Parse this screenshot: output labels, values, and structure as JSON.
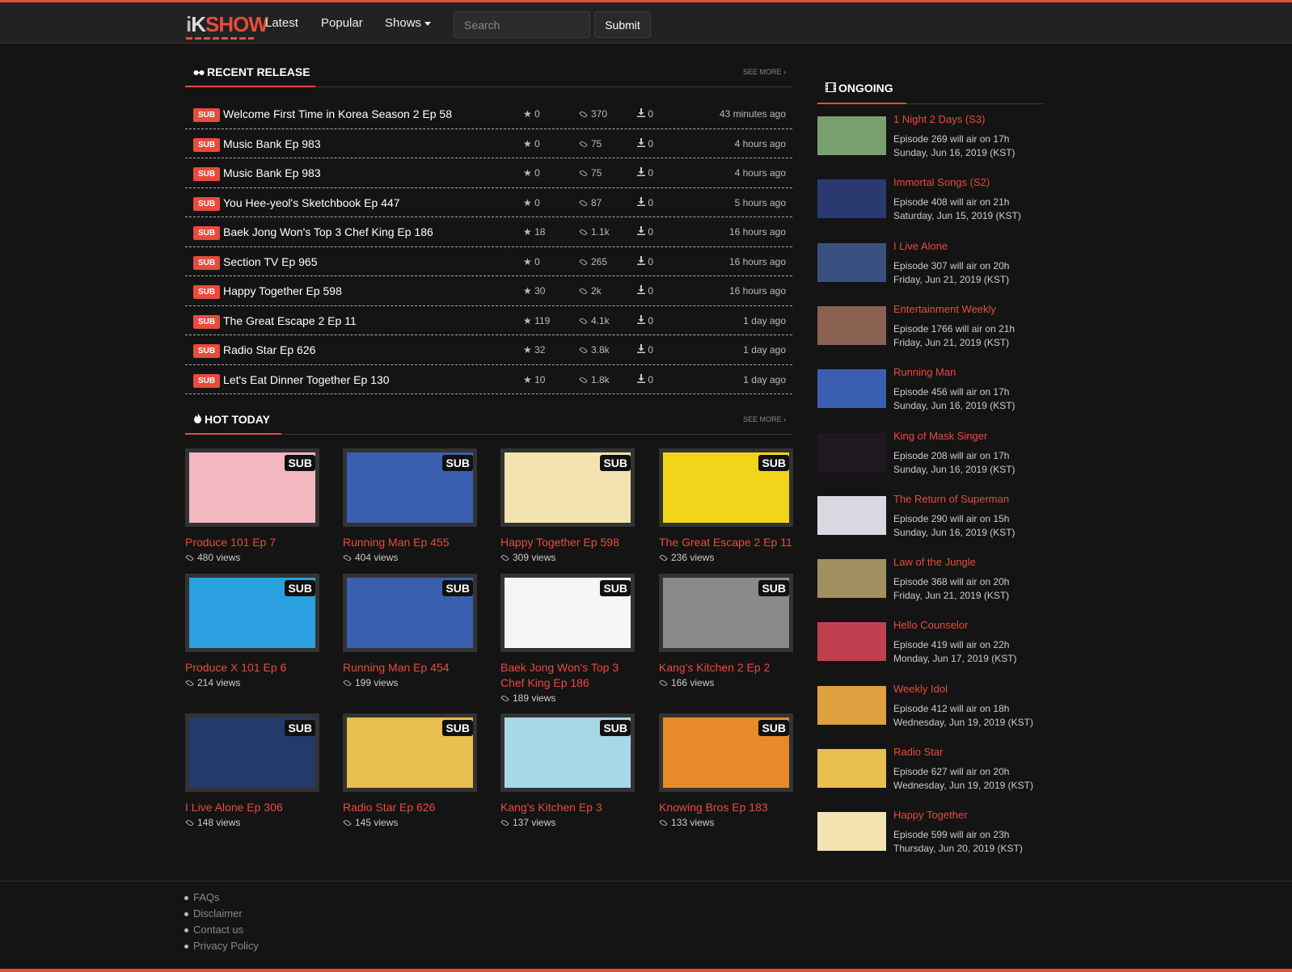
{
  "brand": {
    "logo_i": "i",
    "logo_k": "K",
    "logo_show": "SHOW"
  },
  "nav": {
    "latest": "Latest",
    "popular": "Popular",
    "shows": "Shows",
    "search_placeholder": "Search",
    "submit": "Submit"
  },
  "recent": {
    "title": "RECENT RELEASE",
    "see_more": "SEE MORE",
    "badge": "SUB",
    "items": [
      {
        "title": "Welcome First Time in Korea Season 2 Ep 58",
        "stars": "0",
        "views": "370",
        "downloads": "0",
        "time": "43 minutes ago"
      },
      {
        "title": "Music Bank Ep 983",
        "stars": "0",
        "views": "75",
        "downloads": "0",
        "time": "4 hours ago"
      },
      {
        "title": "Music Bank Ep 983",
        "stars": "0",
        "views": "75",
        "downloads": "0",
        "time": "4 hours ago"
      },
      {
        "title": "You Hee-yeol's Sketchbook Ep 447",
        "stars": "0",
        "views": "87",
        "downloads": "0",
        "time": "5 hours ago"
      },
      {
        "title": "Baek Jong Won's Top 3 Chef King Ep 186",
        "stars": "18",
        "views": "1.1k",
        "downloads": "0",
        "time": "16 hours ago"
      },
      {
        "title": "Section TV Ep 965",
        "stars": "0",
        "views": "265",
        "downloads": "0",
        "time": "16 hours ago"
      },
      {
        "title": "Happy Together Ep 598",
        "stars": "30",
        "views": "2k",
        "downloads": "0",
        "time": "16 hours ago"
      },
      {
        "title": "The Great Escape 2 Ep 11",
        "stars": "119",
        "views": "4.1k",
        "downloads": "0",
        "time": "1 day ago"
      },
      {
        "title": "Radio Star Ep 626",
        "stars": "32",
        "views": "3.8k",
        "downloads": "0",
        "time": "1 day ago"
      },
      {
        "title": "Let's Eat Dinner Together Ep 130",
        "stars": "10",
        "views": "1.8k",
        "downloads": "0",
        "time": "1 day ago"
      }
    ]
  },
  "hot": {
    "title": "HOT TODAY",
    "see_more": "SEE MORE",
    "tag": "SUB",
    "cards": [
      {
        "title": "Produce 101 Ep 7",
        "views": "480 views",
        "color": "#f3b7c0"
      },
      {
        "title": "Running Man Ep 455",
        "views": "404 views",
        "color": "#3a5fb0"
      },
      {
        "title": "Happy Together Ep 598",
        "views": "309 views",
        "color": "#f2e3b0"
      },
      {
        "title": "The Great Escape 2 Ep 11",
        "views": "236 views",
        "color": "#f2d51a"
      },
      {
        "title": "Produce X 101 Ep 6",
        "views": "214 views",
        "color": "#2aa0e0"
      },
      {
        "title": "Running Man Ep 454",
        "views": "199 views",
        "color": "#3a5fb0"
      },
      {
        "title": "Baek Jong Won's Top 3 Chef King Ep 186",
        "views": "189 views",
        "color": "#f5f5f5"
      },
      {
        "title": "Kang's Kitchen 2 Ep 2",
        "views": "166 views",
        "color": "#8a8a8a"
      },
      {
        "title": "I Live Alone Ep 306",
        "views": "148 views",
        "color": "#243a6a"
      },
      {
        "title": "Radio Star Ep 626",
        "views": "145 views",
        "color": "#e8c050"
      },
      {
        "title": "Kang's Kitchen Ep 3",
        "views": "137 views",
        "color": "#a8d8e8"
      },
      {
        "title": "Knowing Bros Ep 183",
        "views": "133 views",
        "color": "#e88a2a"
      }
    ]
  },
  "ongoing": {
    "title": "ONGOING",
    "items": [
      {
        "title": "1 Night 2 Days (S3)",
        "line1": "Episode 269 will air on 17h",
        "line2": "Sunday, Jun 16, 2019 (KST)",
        "color": "#7aa070"
      },
      {
        "title": "Immortal Songs (S2)",
        "line1": "Episode 408 will air on 21h",
        "line2": "Saturday, Jun 15, 2019 (KST)",
        "color": "#2a3a70"
      },
      {
        "title": "I Live Alone",
        "line1": "Episode 307 will air on 20h",
        "line2": "Friday, Jun 21, 2019 (KST)",
        "color": "#3a5080"
      },
      {
        "title": "Entertainment Weekly",
        "line1": "Episode 1766 will air on 21h",
        "line2": "Friday, Jun 21, 2019 (KST)",
        "color": "#8a6050"
      },
      {
        "title": "Running Man",
        "line1": "Episode 456 will air on 17h",
        "line2": "Sunday, Jun 16, 2019 (KST)",
        "color": "#3a5fb0"
      },
      {
        "title": "King of Mask Singer",
        "line1": "Episode 208 will air on 17h",
        "line2": "Sunday, Jun 16, 2019 (KST)",
        "color": "#201820"
      },
      {
        "title": "The Return of Superman",
        "line1": "Episode 290 will air on 15h",
        "line2": "Sunday, Jun 16, 2019 (KST)",
        "color": "#d8d8e0"
      },
      {
        "title": "Law of the Jungle",
        "line1": "Episode 368 will air on 20h",
        "line2": "Friday, Jun 21, 2019 (KST)",
        "color": "#a09060"
      },
      {
        "title": "Hello Counselor",
        "line1": "Episode 419 will air on 22h",
        "line2": "Monday, Jun 17, 2019 (KST)",
        "color": "#c04050"
      },
      {
        "title": "Weekly Idol",
        "line1": "Episode 412 will air on 18h",
        "line2": "Wednesday, Jun 19, 2019 (KST)",
        "color": "#e0a040"
      },
      {
        "title": "Radio Star",
        "line1": "Episode 627 will air on 20h",
        "line2": "Wednesday, Jun 19, 2019 (KST)",
        "color": "#e8c050"
      },
      {
        "title": "Happy Together",
        "line1": "Episode 599 will air on 23h",
        "line2": "Thursday, Jun 20, 2019 (KST)",
        "color": "#f2e3b0"
      }
    ]
  },
  "footer": {
    "links": [
      "FAQs",
      "Disclaimer",
      "Contact us",
      "Privacy Policy"
    ]
  },
  "colors": {
    "accent": "#e74c3c",
    "background": "#141414"
  }
}
